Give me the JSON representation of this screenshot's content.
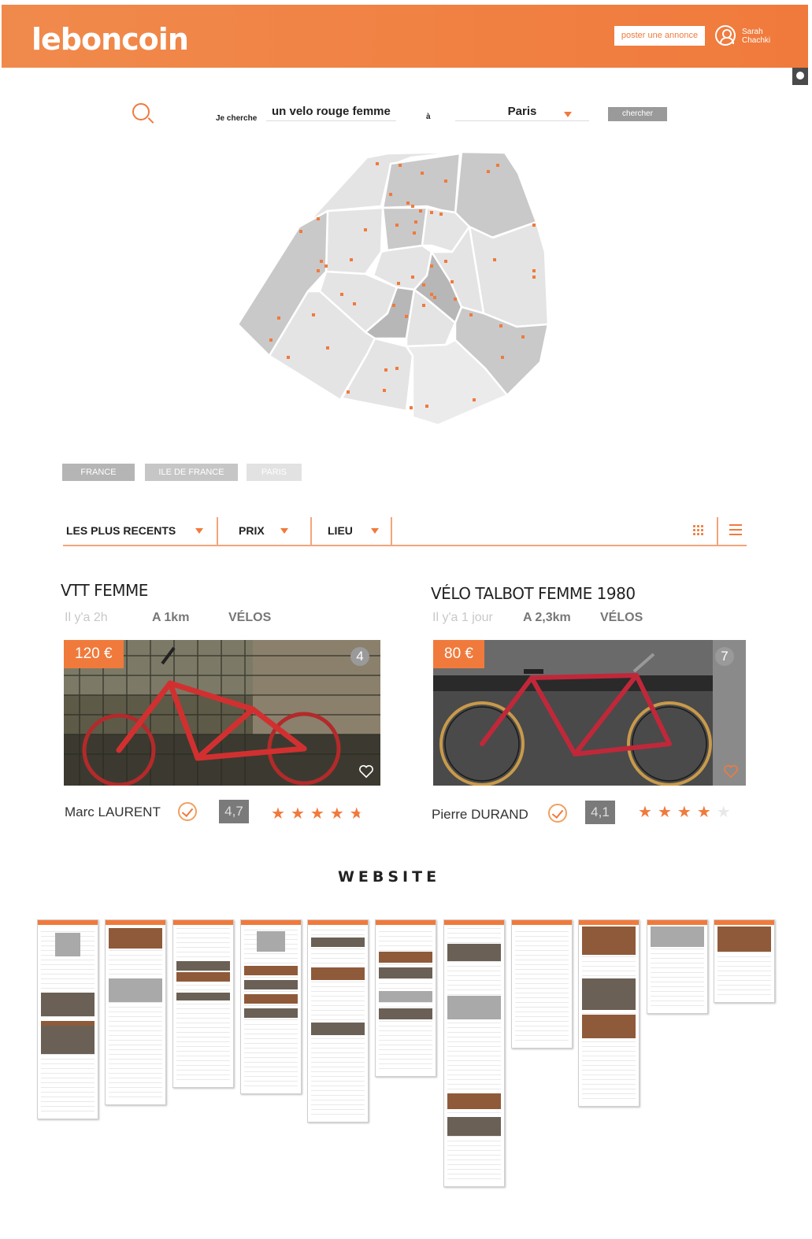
{
  "header": {
    "logo": "leboncoin",
    "post_button": "poster une annonce",
    "user_name": "Sarah Chachki"
  },
  "search": {
    "label_query": "Je cherche",
    "query_value": "un velo rouge femme",
    "label_at": "à",
    "city_value": "Paris",
    "submit_label": "chercher"
  },
  "breadcrumb": [
    "FRANCE",
    "ILE DE FRANCE",
    "PARIS"
  ],
  "filters": {
    "recent": "LES PLUS RECENTS",
    "price": "PRIX",
    "location": "LIEU"
  },
  "listings": [
    {
      "title": "VTT FEMME",
      "age": "Il y'a 2h",
      "distance": "A 1km",
      "category": "VÉLOS",
      "price": "120 €",
      "photo_count": "4",
      "seller": "Marc LAURENT",
      "rating": "4,7",
      "stars": 4.5
    },
    {
      "title": "VÉLO TALBOT FEMME 1980",
      "age": "Il y'a 1 jour",
      "distance": "A 2,3km",
      "category": "VÉLOS",
      "price": "80 €",
      "photo_count": "7",
      "seller": "Pierre DURAND",
      "rating": "4,1",
      "stars": 4
    }
  ],
  "section": {
    "title": "WEBSITE"
  },
  "colors": {
    "accent": "#f07a3c",
    "button_gray": "#9a9a9a"
  }
}
